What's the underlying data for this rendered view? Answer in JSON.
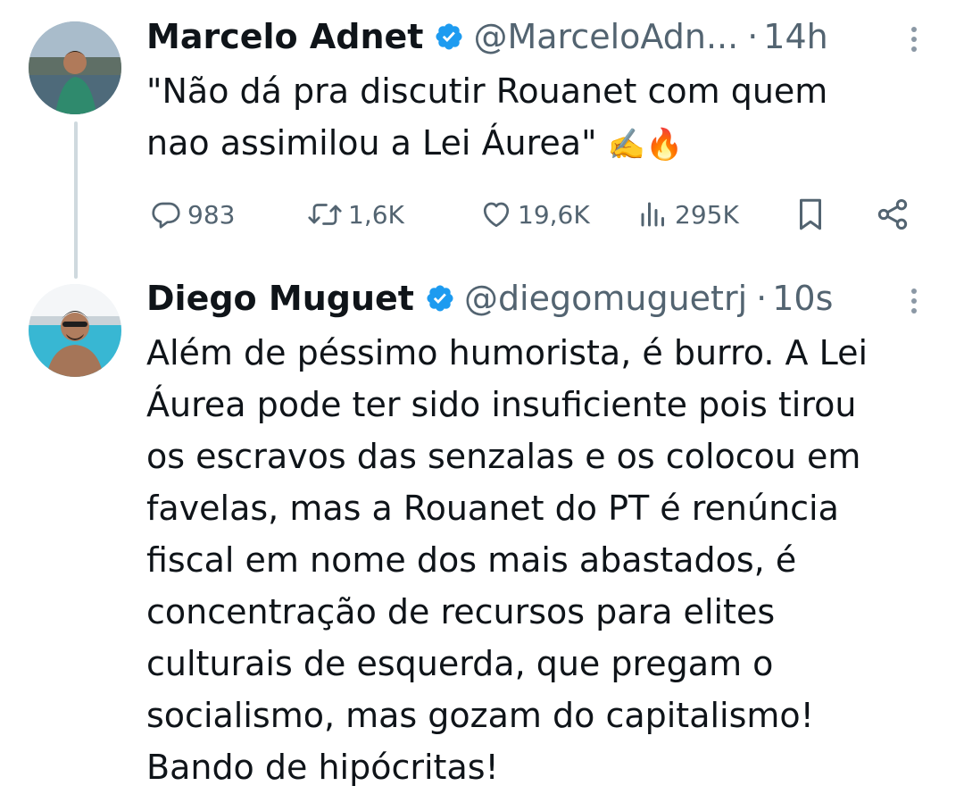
{
  "tweet1": {
    "name": "Marcelo Adnet",
    "handle": "@MarceloAdn...",
    "separator": "·",
    "time": "14h",
    "text": "\"Não dá pra discutir Rouanet com quem\nnao assimilou a Lei Áurea\"",
    "emoji": "✍️🔥",
    "replies": "983",
    "reposts": "1,6K",
    "likes": "19,6K",
    "views": "295K",
    "icons": [
      "reply-icon",
      "repost-icon",
      "like-icon",
      "views-icon",
      "bookmark-icon",
      "share-icon"
    ]
  },
  "tweet2": {
    "name": "Diego Muguet",
    "handle": "@diegomuguetrj",
    "separator": "·",
    "time": "10s",
    "text": "Além de péssimo humorista, é burro. A Lei\nÁurea pode ter sido insuficiente pois tirou\nos escravos das senzalas e os colocou em\nfavelas, mas a Rouanet do PT é renúncia\nfiscal em nome dos mais abastados, é\nconcentração de recursos para elites\nculturais de esquerda, que pregam o\nsocialismo, mas gozam do capitalismo!\nBando de hipócritas!"
  },
  "colors": {
    "verified": "#1d9bf0",
    "secondary_text": "#536471",
    "primary_text": "#0f1419",
    "thread_line": "#cfd9de"
  }
}
